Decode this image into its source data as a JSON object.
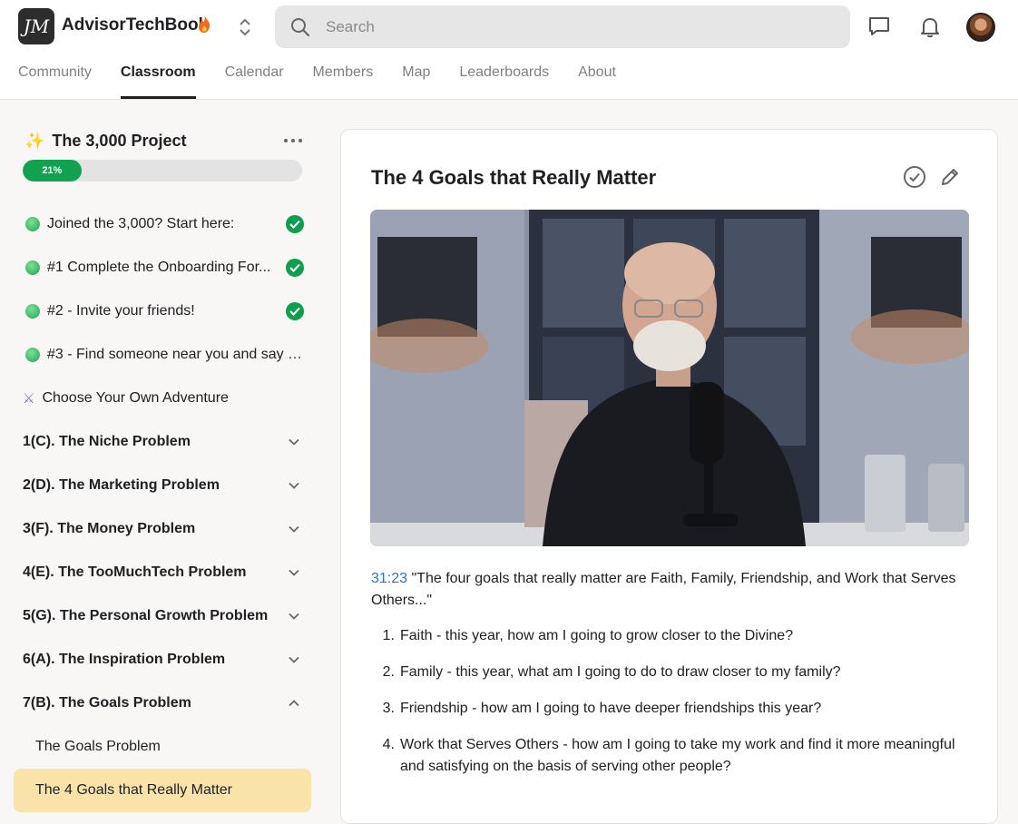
{
  "header": {
    "logo_text": "JM",
    "app_name": "AdvisorTechBook",
    "search_placeholder": "Search",
    "icons": [
      "chat-icon",
      "bell-icon",
      "avatar"
    ],
    "tabs": [
      {
        "label": "Community",
        "active": false
      },
      {
        "label": "Classroom",
        "active": true
      },
      {
        "label": "Calendar",
        "active": false
      },
      {
        "label": "Members",
        "active": false
      },
      {
        "label": "Map",
        "active": false
      },
      {
        "label": "Leaderboards",
        "active": false
      },
      {
        "label": "About",
        "active": false
      }
    ]
  },
  "sidebar": {
    "course_title": "The 3,000 Project",
    "progress_label": "21%",
    "progress_value": 0.21,
    "lessons": [
      {
        "label": "Joined the 3,000? Start here:",
        "completed": true
      },
      {
        "label": "#1 Complete the Onboarding For...",
        "completed": true
      },
      {
        "label": "#2 - Invite your friends!",
        "completed": true
      },
      {
        "label": "#3 - Find someone near you and say \"...",
        "completed": false
      }
    ],
    "adventure_label": "Choose Your Own Adventure",
    "sections": [
      {
        "label": "1(C). The Niche Problem",
        "expanded": false
      },
      {
        "label": "2(D). The Marketing Problem",
        "expanded": false
      },
      {
        "label": "3(F). The Money Problem",
        "expanded": false
      },
      {
        "label": "4(E). The TooMuchTech Problem",
        "expanded": false
      },
      {
        "label": "5(G). The Personal Growth Problem",
        "expanded": false
      },
      {
        "label": "6(A). The Inspiration Problem",
        "expanded": false
      },
      {
        "label": "7(B). The Goals Problem",
        "expanded": true
      }
    ],
    "sub_lessons": [
      {
        "label": "The Goals Problem",
        "active": false
      },
      {
        "label": "The 4 Goals that Really Matter",
        "active": true
      }
    ]
  },
  "content": {
    "title": "The 4 Goals that Really Matter",
    "timestamp": "31:23",
    "quote": " \"The four goals that really matter are Faith, Family, Friendship, and Work that Serves Others...\"",
    "goals": [
      {
        "num": "1.",
        "text": "Faith - this year, how am I going to grow closer to the Divine?"
      },
      {
        "num": "2.",
        "text": "Family - this year, what am I going to do to draw closer to my family?"
      },
      {
        "num": "3.",
        "text": "Friendship - how am I going to have deeper friendships this year?"
      },
      {
        "num": "4.",
        "text": "Work that Serves Others - how am I going to take my work and find it more meaningful and satisfying on the basis of serving other people?"
      }
    ]
  },
  "colors": {
    "accent_green": "#10a151",
    "active_highlight": "#fae3a8",
    "link_blue": "#2f6fd6"
  }
}
